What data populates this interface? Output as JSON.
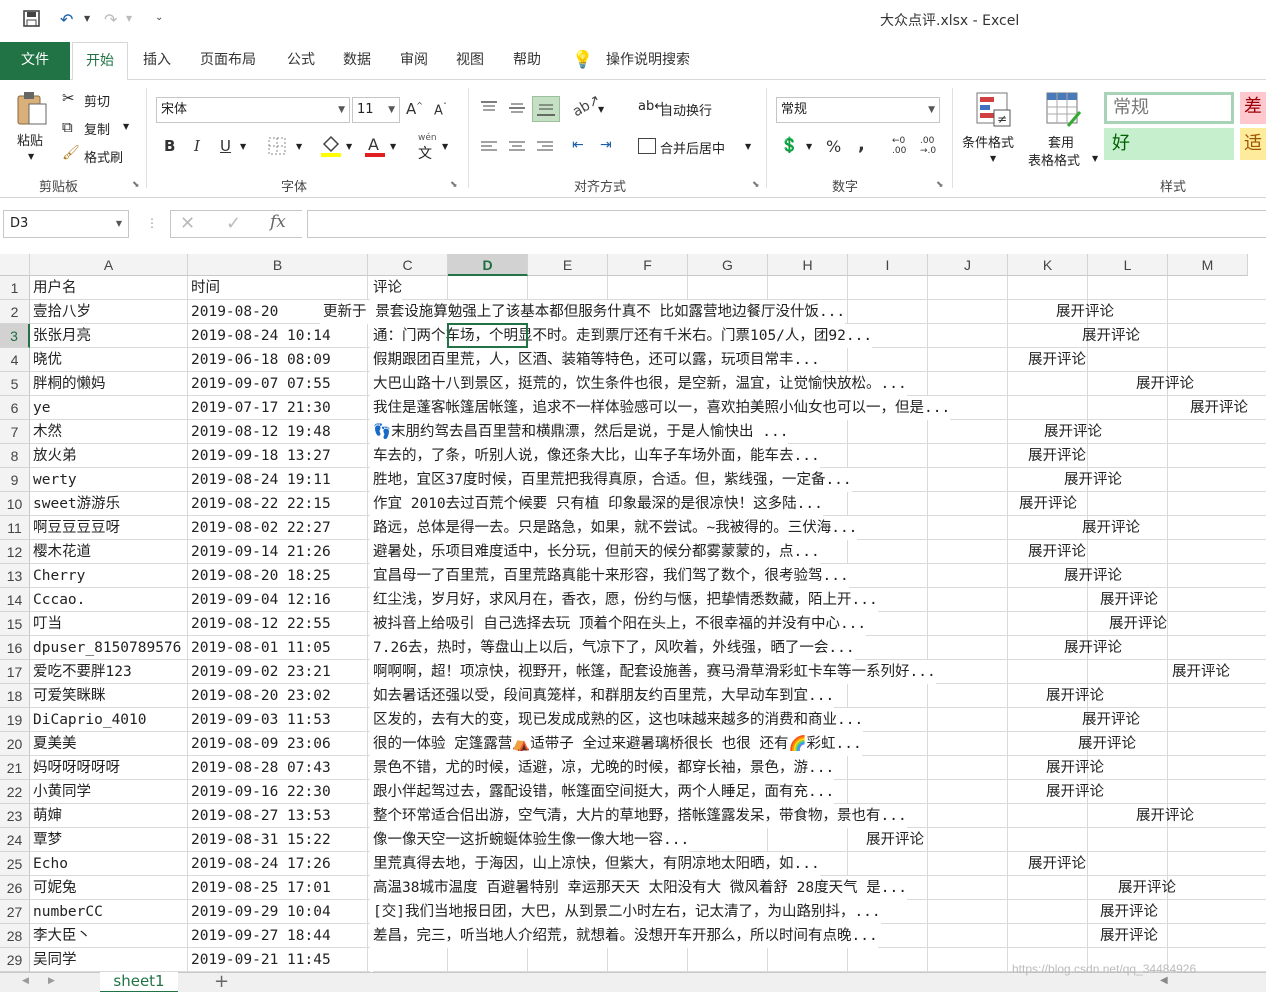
{
  "window": {
    "title": "大众点评.xlsx  -  Excel"
  },
  "qat": {
    "save_icon": "save-icon",
    "undo_icon": "undo-icon",
    "redo_icon": "redo-icon"
  },
  "tabs": [
    "文件",
    "开始",
    "插入",
    "页面布局",
    "公式",
    "数据",
    "审阅",
    "视图",
    "帮助"
  ],
  "tell_me": "操作说明搜索",
  "ribbon": {
    "clipboard": {
      "paste": "粘贴",
      "cut": "剪切",
      "copy": "复制",
      "format_painter": "格式刷",
      "group": "剪贴板"
    },
    "font": {
      "name": "宋体",
      "size": "11",
      "bold": "B",
      "italic": "I",
      "underline": "U",
      "group": "字体",
      "grow": "A",
      "shrink": "A",
      "phonetic": "wén"
    },
    "alignment": {
      "wrap": "自动换行",
      "merge": "合并后居中",
      "group": "对齐方式"
    },
    "number": {
      "format": "常规",
      "percent": "%",
      "comma": ",",
      "group": "数字"
    },
    "styles": {
      "conditional": "条件格式",
      "table_format_1": "套用",
      "table_format_2": "表格格式",
      "normal": "常规",
      "bad": "差",
      "good": "好",
      "neutral": "适",
      "group": "样式"
    }
  },
  "formula_bar": {
    "name_box": "D3",
    "cancel": "✕",
    "enter": "✓",
    "fx": "fx",
    "value": ""
  },
  "columns": [
    "A",
    "B",
    "C",
    "D",
    "E",
    "F",
    "G",
    "H",
    "I",
    "J",
    "K",
    "L",
    "M"
  ],
  "selected_column": "D",
  "selected_row": 3,
  "rows": [
    {
      "n": "1",
      "a": "用户名",
      "b": "时间",
      "c": "评论",
      "exp": ""
    },
    {
      "n": "2",
      "a": "壹拾八岁",
      "b": "2019-08-20",
      "c": "更新于 景套设施算勉强上了该基本都但服务什真不 比如露营地边餐厅没什饭...",
      "exp": "展开评论"
    },
    {
      "n": "3",
      "a": "张张月亮",
      "b": "2019-08-24 10:14",
      "c": "通：门两个车场，个明显不时。走到票厅还有千米右。门票105/人，团92...",
      "exp": "展开评论"
    },
    {
      "n": "4",
      "a": "晓优",
      "b": "2019-06-18 08:09",
      "c": "假期跟团百里荒，人，区酒、装箱等特色，还可以露，玩项目常丰...",
      "exp": "展开评论"
    },
    {
      "n": "5",
      "a": "胖桐的懒妈",
      "b": "2019-09-07 07:55",
      "c": "大巴山路十八到景区，挺荒的，饮生条件也很，是空新，温宜，让觉愉快放松。...",
      "exp": "展开评论"
    },
    {
      "n": "6",
      "a": "ye",
      "b": "2019-07-17 21:30",
      "c": "我住是蓬客帐篷居帐篷，追求不一样体验感可以一，喜欢拍美照小仙女也可以一，但是...",
      "exp": "展开评论"
    },
    {
      "n": "7",
      "a": "木然",
      "b": "2019-08-12 19:48",
      "c": "👣末朋约驾去昌百里营和横鼎漂，然后是说，于是人愉快出        ...",
      "exp": "展开评论"
    },
    {
      "n": "8",
      "a": "放火弟",
      "b": "2019-09-18 13:27",
      "c": "车去的，了条，听别人说，像还条大比，山车子车场外面，能车去...",
      "exp": "展开评论"
    },
    {
      "n": "9",
      "a": "werty",
      "b": "2019-08-24 19:11",
      "c": "胜地，宜区37度时候，百里荒把我得真原，合适。但，紫线强，一定备...",
      "exp": "展开评论"
    },
    {
      "n": "10",
      "a": "sweet游游乐",
      "b": "2019-08-22 22:15",
      "c": "作宜 2010去过百荒个候要 只有植 印象最深的是很凉快！这多陆...",
      "exp": "展开评论"
    },
    {
      "n": "11",
      "a": "啊豆豆豆豆呀",
      "b": "2019-08-02 22:27",
      "c": "路远，总体是得一去。只是路急，如果，就不尝试。~我被得的。三伏海...",
      "exp": "展开评论"
    },
    {
      "n": "12",
      "a": "樱木花道",
      "b": "2019-09-14 21:26",
      "c": "避暑处，乐项目难度适中，长分玩，但前天的候分都雾蒙蒙的，点...",
      "exp": "展开评论"
    },
    {
      "n": "13",
      "a": "Cherry",
      "b": "2019-08-20 18:25",
      "c": "宜昌母一了百里荒，百里荒路真能十来形容，我们驾了数个，很考验驾...",
      "exp": "展开评论"
    },
    {
      "n": "14",
      "a": "Cccao.",
      "b": "2019-09-04 12:16",
      "c": "红尘浅，岁月好，求风月在，香衣，愿，份约与惬，把挚情悉数藏，陌上开...",
      "exp": "展开评论"
    },
    {
      "n": "15",
      "a": "叮当",
      "b": "2019-08-12 22:55",
      "c": "被抖音上给吸引 自己选择去玩    顶着个阳在头上，不很幸福的并没有中心...",
      "exp": "展开评论"
    },
    {
      "n": "16",
      "a": "dpuser_8150789576",
      "b": "2019-08-01 11:05",
      "c": "7.26去，热时，等盘山上以后，气凉下了，风吹着，外线强，晒了一会...",
      "exp": "展开评论"
    },
    {
      "n": "17",
      "a": "爱吃不要胖123",
      "b": "2019-09-02 23:21",
      "c": "啊啊啊，超！项凉快，视野开，帐篷，配套设施善，赛马滑草滑彩虹卡车等一系列好...",
      "exp": "展开评论"
    },
    {
      "n": "18",
      "a": "可爱笑眯眯",
      "b": "2019-08-20 23:02",
      "c": "如去暑话还强以受，段间真笼样，和群朋友约百里荒，大早动车到宜...",
      "exp": "展开评论"
    },
    {
      "n": "19",
      "a": "DiCaprio_4010",
      "b": "2019-09-03 11:53",
      "c": "区发的，去有大的变，现已发成成熟的区，这也味越来越多的消费和商业...",
      "exp": "展开评论"
    },
    {
      "n": "20",
      "a": "夏美美",
      "b": "2019-08-09 23:06",
      "c": "很的一体验 定篷露营⛺适带子 全过来避暑璃桥很长 也很 还有🌈彩虹...",
      "exp": "展开评论"
    },
    {
      "n": "21",
      "a": "妈呀呀呀呀呀",
      "b": "2019-08-28 07:43",
      "c": "景色不错，尤的时候，适避，凉，尤晚的时候，都穿长袖，景色，游...",
      "exp": "展开评论"
    },
    {
      "n": "22",
      "a": "小黄同学",
      "b": "2019-09-16 22:30",
      "c": "跟小伴起驾过去，露配设错，帐篷面空间挺大，两个人睡足，面有充...",
      "exp": "展开评论"
    },
    {
      "n": "23",
      "a": "萌婶",
      "b": "2019-08-27 13:53",
      "c": "整个环常适合侣出游，空气清，大片的草地野，搭帐篷露发呆，带食物，景也有...",
      "exp": "展开评论"
    },
    {
      "n": "24",
      "a": "覃梦",
      "b": "2019-08-31 15:22",
      "c": "像一像天空一这折蜿蜒体验生像一像大地一容...",
      "exp": "展开评论"
    },
    {
      "n": "25",
      "a": "Echo",
      "b": "2019-08-24 17:26",
      "c": "里荒真得去地，于海因，山上凉快，但紫大，有阴凉地太阳晒，如...",
      "exp": "展开评论"
    },
    {
      "n": "26",
      "a": "可妮兔",
      "b": "2019-08-25 17:01",
      "c": "高温38城市温度 百避暑特别 幸运那天天 太阳没有大 微风着舒 28度天气 是...",
      "exp": "展开评论"
    },
    {
      "n": "27",
      "a": "numberCC",
      "b": "2019-09-29 10:04",
      "c": "[交]我们当地报日团，大巴，从到景二小时左右，记太清了，为山路别抖，...",
      "exp": "展开评论"
    },
    {
      "n": "28",
      "a": "李大臣丶",
      "b": "2019-09-27 18:44",
      "c": "差昌，完三，听当地人介绍荒，就想着。没想开车开那么，所以时间有点晚...",
      "exp": "展开评论"
    },
    {
      "n": "29",
      "a": "吴同学",
      "b": "2019-09-21 11:45",
      "c": "",
      "exp": ""
    }
  ],
  "sheet": {
    "tab": "sheet1",
    "add": "+",
    "watermark": "https://blog.csdn.net/qq_34484926"
  }
}
